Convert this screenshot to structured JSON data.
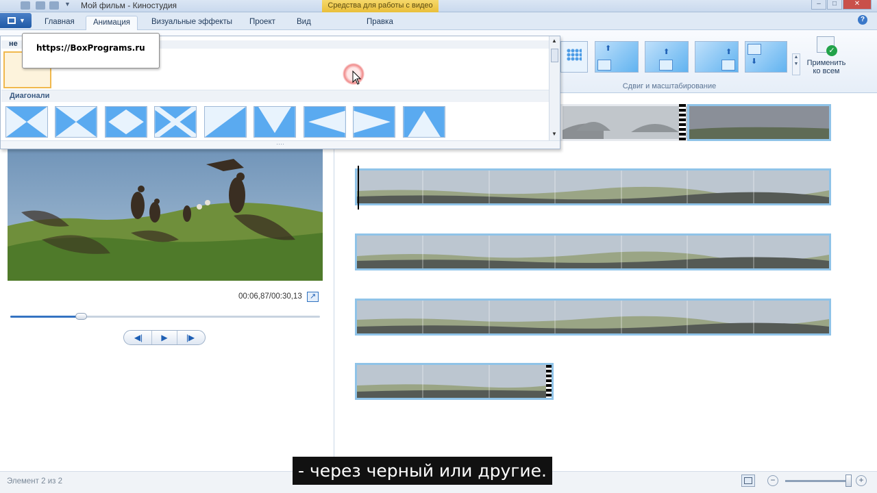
{
  "window": {
    "title": "Мой фильм - Киностудия",
    "contextual_tab_group": "Средства для работы с видео"
  },
  "ribbon_tabs": [
    {
      "label": "Главная"
    },
    {
      "label": "Анимация"
    },
    {
      "label": "Визуальные эффекты"
    },
    {
      "label": "Проект"
    },
    {
      "label": "Вид"
    },
    {
      "label": "Правка"
    }
  ],
  "active_tab": "Анимация",
  "ribbon": {
    "pan_zoom_group_label": "Сдвиг и масштабирование",
    "apply_all_label": "Применить\nко всем"
  },
  "gallery": {
    "first_section_header": "не",
    "second_section_header": "Диагонали"
  },
  "tooltip": {
    "text": "https://BoxPrograms.ru"
  },
  "player": {
    "timecode": "00:06,87/00:30,13",
    "progress": 0.23,
    "prev_frame": "◀|",
    "play": "▶",
    "next_frame": "|▶"
  },
  "status": {
    "item_text": "Элемент 2 из 2",
    "zoom_out": "−",
    "zoom_in": "+"
  },
  "subtitle": "- через черный или другие.",
  "colors": {
    "ribbon_bg": "#e6eef8",
    "contextual_tab": "#e9bf3a",
    "strip_border": "#8fc3e8",
    "accent": "#3473c2"
  }
}
